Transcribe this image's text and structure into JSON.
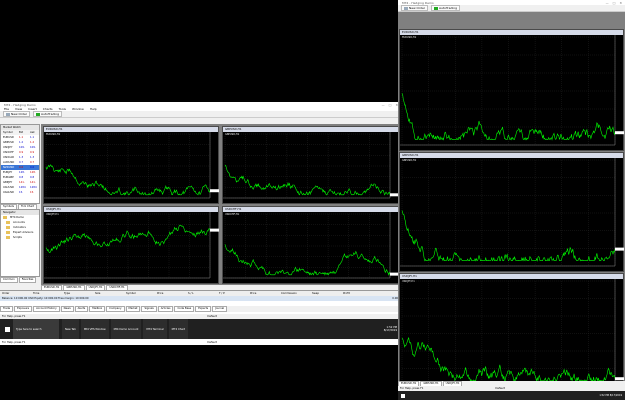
{
  "left": {
    "window_title": "MT4 - Hedging Demo",
    "menu": [
      "File",
      "View",
      "Insert",
      "Charts",
      "Tools",
      "Window",
      "Help"
    ],
    "toolbar": [
      "New Order",
      "AutoTrading"
    ],
    "market_watch": {
      "title": "Market Watch",
      "columns": [
        "Symbol",
        "Bid",
        "Ask"
      ],
      "rows": [
        {
          "symbol": "EURUSD",
          "bid": "1.1",
          "ask": "1.1"
        },
        {
          "symbol": "GBPUSD",
          "bid": "1.2",
          "ask": "1.2"
        },
        {
          "symbol": "USDJPY",
          "bid": "109.",
          "ask": "109."
        },
        {
          "symbol": "USDCHF",
          "bid": "0.9",
          "ask": "0.9"
        },
        {
          "symbol": "USDCAD",
          "bid": "1.3",
          "ask": "1.3"
        },
        {
          "symbol": "AUDUSD",
          "bid": "0.7",
          "ask": "0.7"
        },
        {
          "symbol": "NZDUSD",
          "bid": "0.6",
          "ask": "0.6"
        },
        {
          "symbol": "EURJPY",
          "bid": "128.",
          "ask": "128."
        },
        {
          "symbol": "EURGBP",
          "bid": "0.8",
          "ask": "0.8"
        },
        {
          "symbol": "GBPJPY",
          "bid": "141.",
          "ask": "141."
        },
        {
          "symbol": "XAUUSD",
          "bid": "1284",
          "ask": "1284"
        },
        {
          "symbol": "XAGUSD",
          "bid": "15.",
          "ask": "15."
        }
      ],
      "tabs": [
        "Symbols",
        "Tick Chart"
      ]
    },
    "navigator": {
      "title": "Navigator",
      "items": [
        "MT4 Demo",
        "Accounts",
        "Indicators",
        "Expert Advisors",
        "Scripts"
      ],
      "tabs": [
        "Common",
        "Favorites"
      ]
    },
    "chart_titles": [
      "EURUSD,H1",
      "GBPUSD,H1",
      "USDJPY,H1",
      "USDCHF,H1"
    ],
    "chart_tabs": [
      "EURUSD,H1",
      "GBPUSD,H1",
      "USDJPY,H1",
      "USDCHF,H1"
    ],
    "terminal": {
      "columns": [
        "Order",
        "Time",
        "Type",
        "Size",
        "Symbol",
        "Price",
        "S / L",
        "T / P",
        "Price",
        "Commission",
        "Swap",
        "Profit"
      ],
      "balance_line": "Balance: 10 000.00 USD  Equity: 10 000.00  Free margin: 10 000.00",
      "profit": "0.00",
      "tabs": [
        "Trade",
        "Exposure",
        "Account History",
        "News",
        "Alerts",
        "Mailbox",
        "Company",
        "Market",
        "Signals",
        "Articles",
        "Code Base",
        "Experts",
        "Journal"
      ]
    },
    "status_help": "For Help, press F1",
    "status_mid": "Default"
  },
  "taskbar_left": {
    "search": "Type here to search",
    "tasks": [
      "New Tab",
      "Mt4 VPS Window",
      "Mt4 Demo Account",
      "MT4 Terminal",
      "MT4 Chart"
    ],
    "time": "1:52 PM",
    "date": "8/17/2019"
  },
  "right": {
    "window_title": "MT4 - Hedging Demo",
    "chart_titles": [
      "EURUSD,H1",
      "GBPUSD,H1",
      "USDJPY,H1"
    ],
    "chart_tabs": [
      "EURUSD,H1",
      "GBPUSD,H1",
      "USDJPY,H1"
    ],
    "status_help": "For Help, press F1",
    "status_mid": "Default",
    "time": "1:52 PM",
    "date": "8/17/2019"
  },
  "colors": {
    "line": "#00ff00",
    "price_tag": "#ffffff",
    "title_bg": "#d6dbe9"
  }
}
